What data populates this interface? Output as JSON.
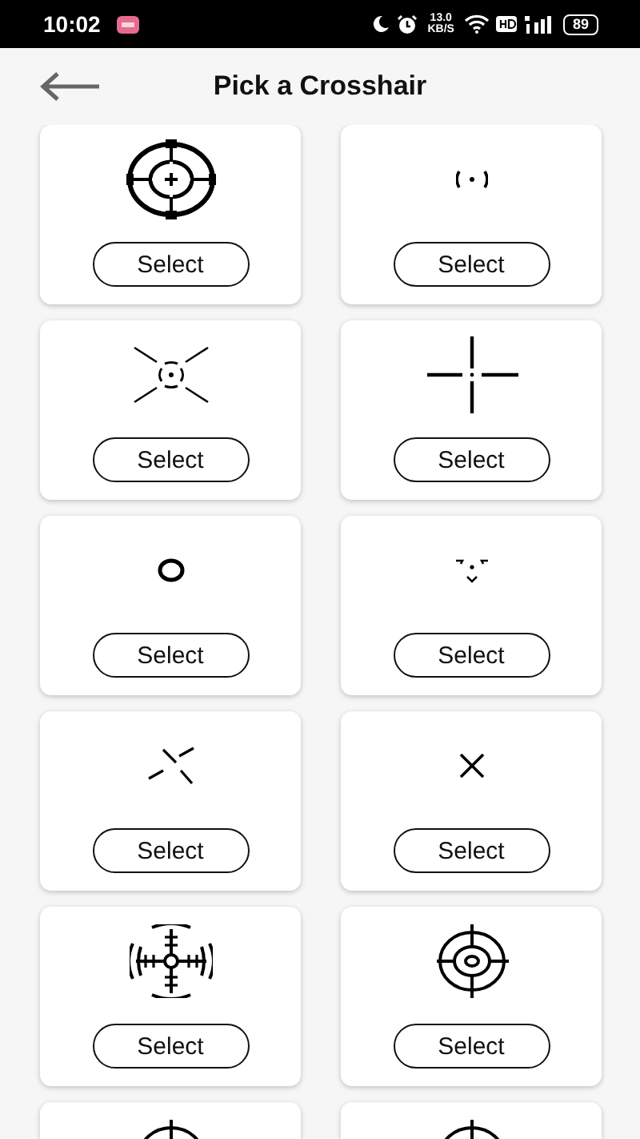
{
  "status_bar": {
    "time": "10:02",
    "speed": "13.0",
    "speed_unit": "KB/S",
    "battery": "89"
  },
  "header": {
    "title": "Pick a Crosshair"
  },
  "crosshairs": [
    {
      "kind": "target-ticks",
      "button": "Select"
    },
    {
      "kind": "dot-brackets",
      "button": "Select"
    },
    {
      "kind": "dot-ring-rays",
      "button": "Select"
    },
    {
      "kind": "gap-cross",
      "button": "Select"
    },
    {
      "kind": "ring",
      "button": "Select"
    },
    {
      "kind": "dot-chevrons",
      "button": "Select"
    },
    {
      "kind": "pinwheel",
      "button": "Select"
    },
    {
      "kind": "x-mark",
      "button": "Select"
    },
    {
      "kind": "bracket-scope",
      "button": "Select"
    },
    {
      "kind": "circle-scope",
      "button": "Select"
    },
    {
      "kind": "circle-scope"
    },
    {
      "kind": "circle-scope"
    }
  ]
}
